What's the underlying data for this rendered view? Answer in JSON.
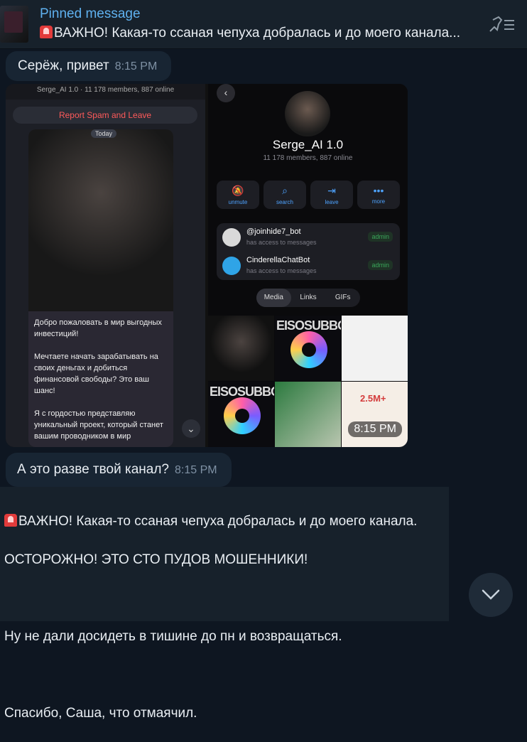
{
  "pinned": {
    "title": "Pinned message",
    "text": "ВАЖНО! Какая-то ссаная чепуха добралась и до моего канала..."
  },
  "messages": [
    {
      "text": "Серёж, привет",
      "time": "8:15 PM"
    },
    {
      "text": "А это разве твой канал?",
      "time": "8:15 PM"
    }
  ],
  "photo": {
    "time": "8:15 PM",
    "left": {
      "topbar": "Serge_AI 1.0 · 11 178 members, 887 online",
      "spam_bar": "Report Spam and Leave",
      "today": "Today",
      "post_text": "Добро пожаловать в мир выгодных инвестиций!\n\nМечтаете начать зарабатывать на своих деньгах и добиться финансовой свободы? Это ваш шанс!\n\nЯ с гордостью представляю уникальный проект, который станет вашим проводником в мир"
    },
    "right": {
      "channel_name": "Serge_AI 1.0",
      "channel_sub": "11 178 members, 887 online",
      "actions": [
        "unmute",
        "search",
        "leave",
        "more"
      ],
      "bots": [
        {
          "name": "@joinhide7_bot",
          "sub": "has access to messages",
          "badge": "admin"
        },
        {
          "name": "CinderellaChatBot",
          "sub": "has access to messages",
          "badge": "admin"
        }
      ],
      "media_tabs": [
        "Media",
        "Links",
        "GIFs"
      ],
      "grid_text_1": "EISOSUBBO",
      "grid_text_2": "EISOSUBBO",
      "grid_price": "2.5M+"
    }
  },
  "forwarded": {
    "line1": "ВАЖНО! Какая-то ссаная чепуха добралась и до моего канала.",
    "line2": "ОСТОРОЖНО! ЭТО СТО ПУДОВ МОШЕННИКИ!",
    "line3": "Ну не дали досидеть в тишине до пн и возвращаться.",
    "line4": "Спасибо, Саша, что отмаячил."
  }
}
